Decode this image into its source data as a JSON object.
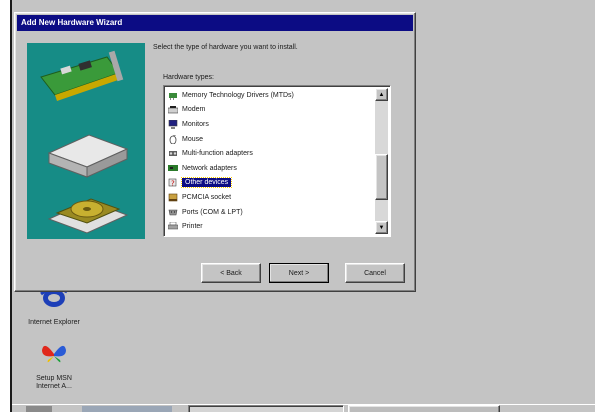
{
  "wizard": {
    "title": "Add New Hardware Wizard",
    "instruction": "Select the type of hardware you want to install.",
    "list_label": "Hardware types:",
    "hardware_types": [
      {
        "label": "Memory Technology Drivers (MTDs)",
        "icon": "memory-chip-icon",
        "selected": false
      },
      {
        "label": "Modem",
        "icon": "modem-icon",
        "selected": false
      },
      {
        "label": "Monitors",
        "icon": "monitor-icon",
        "selected": false
      },
      {
        "label": "Mouse",
        "icon": "mouse-icon",
        "selected": false
      },
      {
        "label": "Multi-function adapters",
        "icon": "multifunction-adapter-icon",
        "selected": false
      },
      {
        "label": "Network adapters",
        "icon": "network-adapter-icon",
        "selected": false
      },
      {
        "label": "Other devices",
        "icon": "question-device-icon",
        "selected": true
      },
      {
        "label": "PCMCIA socket",
        "icon": "pcmcia-icon",
        "selected": false
      },
      {
        "label": "Ports (COM & LPT)",
        "icon": "port-icon",
        "selected": false
      },
      {
        "label": "Printer",
        "icon": "printer-icon",
        "selected": false
      }
    ],
    "buttons": {
      "back": "< Back",
      "next": "Next >",
      "cancel": "Cancel"
    }
  },
  "desktop": {
    "icons": [
      {
        "label": "Internet Explorer",
        "icon": "internet-explorer-icon"
      },
      {
        "label": "Setup MSN Internet A...",
        "icon": "msn-butterfly-icon"
      }
    ]
  },
  "colors": {
    "desktop": "#c4c4c4",
    "titlebar": "#0c0c84",
    "illustration": "#168c86",
    "selection": "#0c0c84"
  }
}
